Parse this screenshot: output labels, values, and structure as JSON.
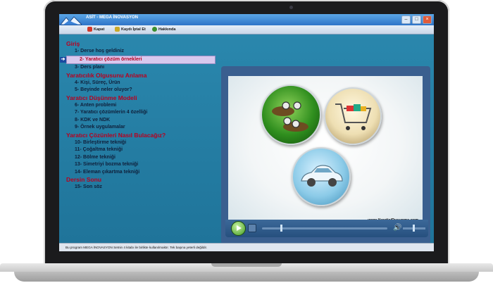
{
  "window": {
    "title": "ASİT - MEGA İNOVASYON"
  },
  "toolbar": {
    "items": [
      {
        "label": "Kapat",
        "icon": "close-app-icon"
      },
      {
        "label": "Kaydı İptal Et",
        "icon": "cancel-registration-icon"
      },
      {
        "label": "Hakkında",
        "icon": "info-icon"
      }
    ]
  },
  "menu": {
    "sections": [
      {
        "title": "Giriş",
        "items": [
          "1- Derse hoş geldiniz",
          "2- Yaratıcı çözüm örnekleri",
          "3- Ders planı"
        ]
      },
      {
        "title": "Yaratıcılık Olgusunu Anlama",
        "items": [
          "4- Kişi, Süreç, Ürün",
          "5- Beyinde neler oluyor?"
        ]
      },
      {
        "title": "Yaratıcı Düşünme Modeli",
        "items": [
          "6- Anten problemi",
          "7- Yaratıcı çözümlerin 4 özelliği",
          "8- KDK ve NDK",
          "9- Örnek uygulamalar"
        ]
      },
      {
        "title": "Yaratıcı Çözünleri Nasıl Bulacağız?",
        "items": [
          "10- Birleştirme tekniği",
          "11- Çoğaltma tekniği",
          "12- Bölme tekniği",
          "13- Simetriyi bozma tekniği",
          "14- Eleman çıkartma tekniği"
        ]
      },
      {
        "title": "Dersin Sonu",
        "items": [
          "15- Son söz"
        ]
      }
    ],
    "selected": "2- Yaratıcı çözüm örnekleri"
  },
  "video": {
    "watermark": "www.YaraticiDusunme.com",
    "images": [
      "magnifier-field-image",
      "shopping-cart-image",
      "car-image"
    ]
  },
  "player": {
    "progress": 0.45,
    "volume": 0.45
  },
  "status": {
    "text": "Bu program MEGA İNOVASYON Setnin 4 kitabı ile birlikte kullanılmaktır. Tek başına yeterli değildir."
  },
  "colors": {
    "section_title": "#b8001f",
    "selected_bg": "#d8c9ee",
    "content_bg": "#1f749a"
  }
}
